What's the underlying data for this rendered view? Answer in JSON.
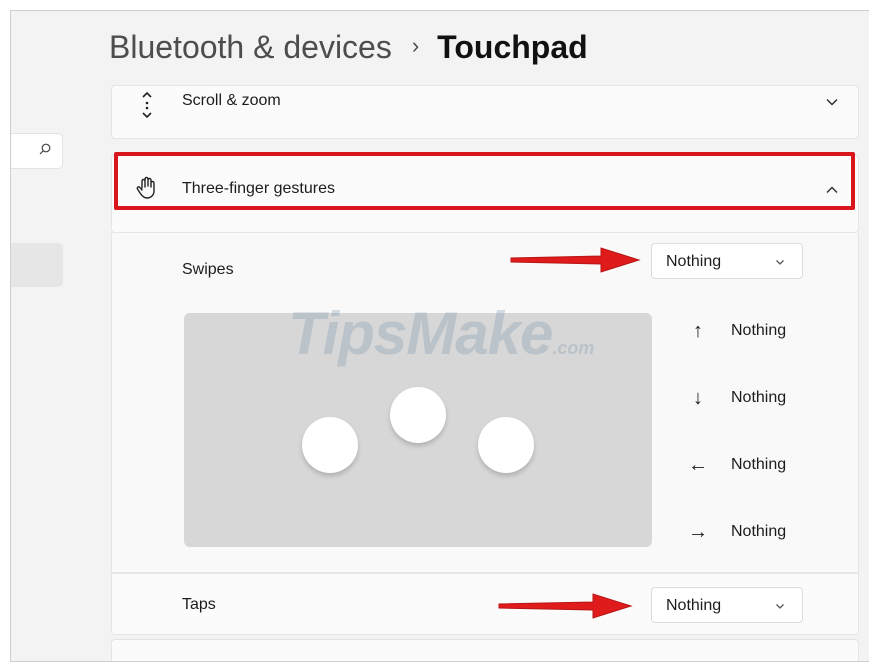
{
  "header": {
    "parent": "Bluetooth & devices",
    "separator": "›",
    "current": "Touchpad"
  },
  "sections": {
    "scroll_zoom": {
      "label": "Scroll & zoom",
      "icon": "scroll-arrows-icon",
      "expanded": false
    },
    "three_finger": {
      "label": "Three-finger gestures",
      "icon": "hand-icon",
      "expanded": true
    }
  },
  "swipes": {
    "label": "Swipes",
    "selected": "Nothing",
    "directions": [
      {
        "icon": "arrow-up-icon",
        "glyph": "↑",
        "value": "Nothing"
      },
      {
        "icon": "arrow-down-icon",
        "glyph": "↓",
        "value": "Nothing"
      },
      {
        "icon": "arrow-left-icon",
        "glyph": "←",
        "value": "Nothing"
      },
      {
        "icon": "arrow-right-icon",
        "glyph": "→",
        "value": "Nothing"
      }
    ]
  },
  "taps": {
    "label": "Taps",
    "selected": "Nothing"
  },
  "watermark": {
    "brand": "TipsMake",
    "suffix": ".com"
  },
  "colors": {
    "highlight": "#d9161c",
    "arrow": "#e01b1b",
    "preview_bg": "#d7d7d7"
  }
}
